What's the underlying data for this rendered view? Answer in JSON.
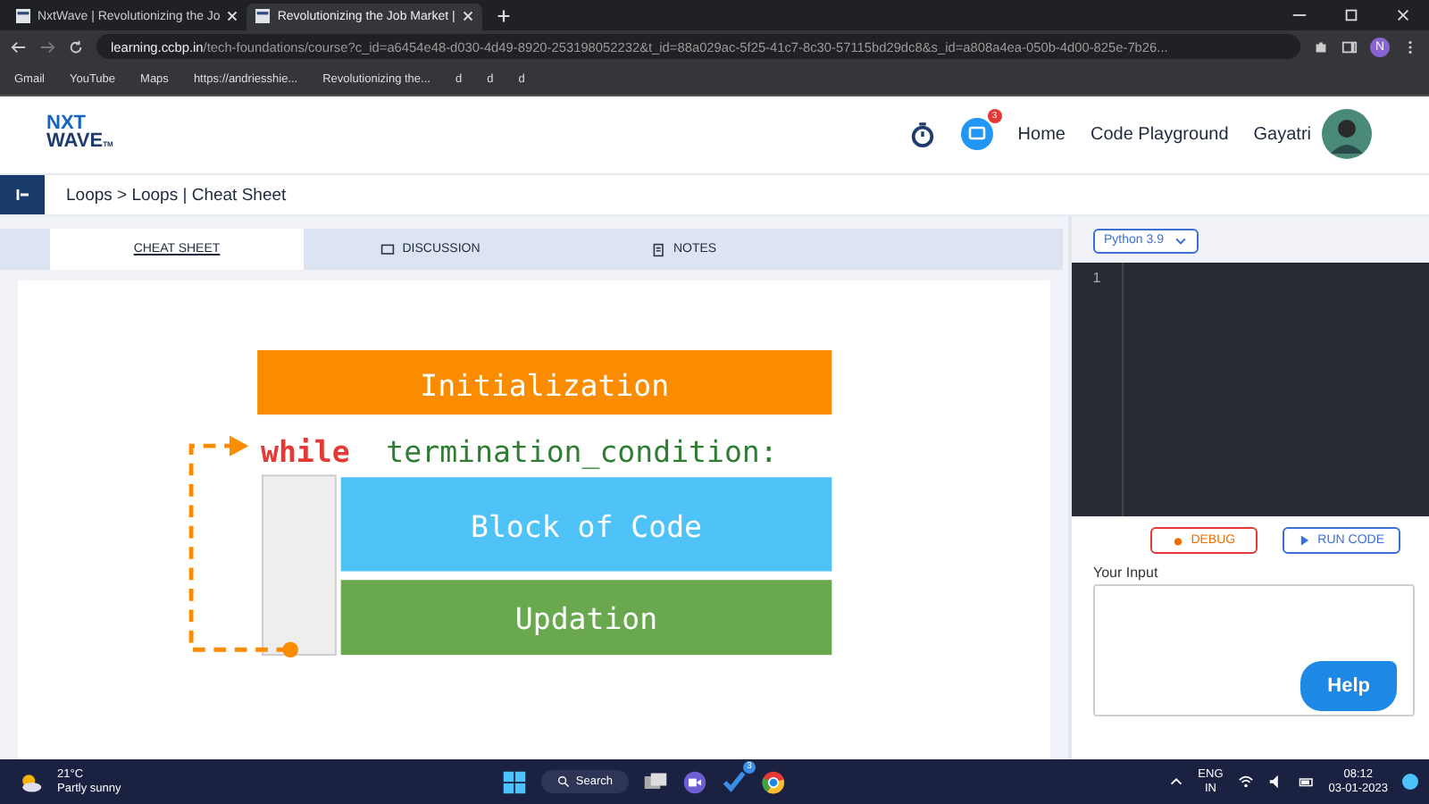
{
  "browser": {
    "tabs": [
      {
        "title": "NxtWave | Revolutionizing the Jo",
        "selected": false
      },
      {
        "title": "Revolutionizing the Job Market |",
        "selected": true
      }
    ],
    "url_host": "learning.ccbp.in",
    "url_path": "/tech-foundations/course?c_id=a6454e48-d030-4d49-8920-253198052232&t_id=88a029ac-5f25-41c7-8c30-57115bd29dc8&s_id=a808a4ea-050b-4d00-825e-7b26...",
    "profile_initial": "N",
    "bookmarks": [
      "Gmail",
      "YouTube",
      "Maps",
      "https://andriesshie...",
      "Revolutionizing the...",
      "d",
      "d",
      "d"
    ]
  },
  "header": {
    "logo_top": "NXT",
    "logo_bottom": "WAVE",
    "logo_tm": "TM",
    "chat_badge": "3",
    "nav": [
      "Home",
      "Code Playground"
    ],
    "user": "Gayatri"
  },
  "breadcrumb": "Loops > Loops | Cheat Sheet",
  "content_tabs": [
    {
      "label": "CHEAT SHEET",
      "kind": "plain",
      "selected": true
    },
    {
      "label": "DISCUSSION",
      "kind": "chat",
      "selected": false
    },
    {
      "label": "NOTES",
      "kind": "notes",
      "selected": false
    }
  ],
  "diagram": {
    "init": "Initialization",
    "keyword": "while",
    "condition": "termination_condition:",
    "block": "Block of Code",
    "update": "Updation"
  },
  "editor": {
    "language": "Python 3.9",
    "line_numbers": [
      "1"
    ],
    "debug": "DEBUG",
    "run": "RUN CODE",
    "input_label": "Your Input",
    "help": "Help"
  },
  "taskbar": {
    "temp": "21°C",
    "weather": "Partly sunny",
    "search": "Search",
    "app_badge": "3",
    "lang_top": "ENG",
    "lang_bottom": "IN",
    "time": "08:12",
    "date": "03-01-2023"
  }
}
